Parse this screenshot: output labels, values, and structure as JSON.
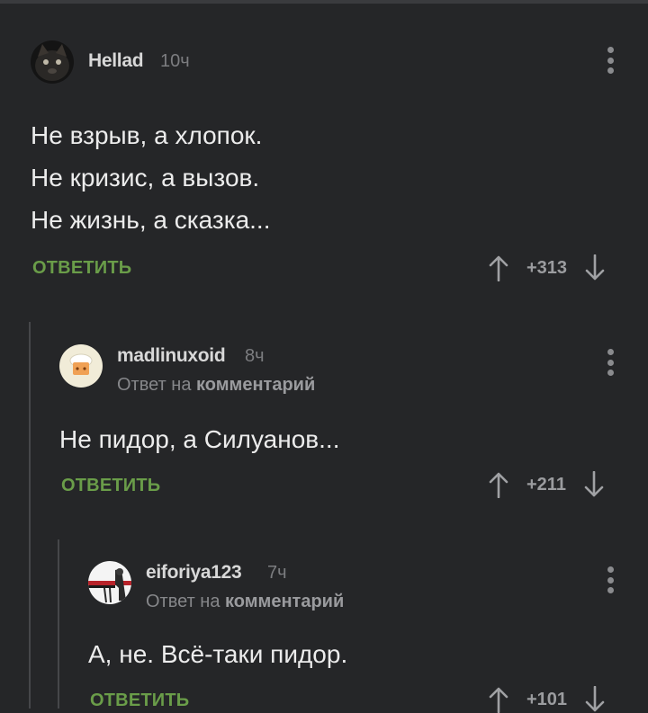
{
  "comments": [
    {
      "author": "Hellad",
      "time": "10ч",
      "lines": [
        "Не взрыв, а хлопок.",
        "Не кризис, а вызов.",
        "Не жизнь, а сказка..."
      ],
      "reply_label": "ОТВЕТИТЬ",
      "score": "+313"
    },
    {
      "author": "madlinuxoid",
      "time": "8ч",
      "reply_prefix": "Ответ на",
      "reply_target": "комментарий",
      "lines": [
        "Не пидор, а Силуанов..."
      ],
      "reply_label": "ОТВЕТИТЬ",
      "score": "+211"
    },
    {
      "author": "eiforiya123",
      "time": "7ч",
      "reply_prefix": "Ответ на",
      "reply_target": "комментарий",
      "lines": [
        "А, не. Всё-таки пидор."
      ],
      "reply_label": "ОТВЕТИТЬ",
      "score": "+101"
    }
  ]
}
